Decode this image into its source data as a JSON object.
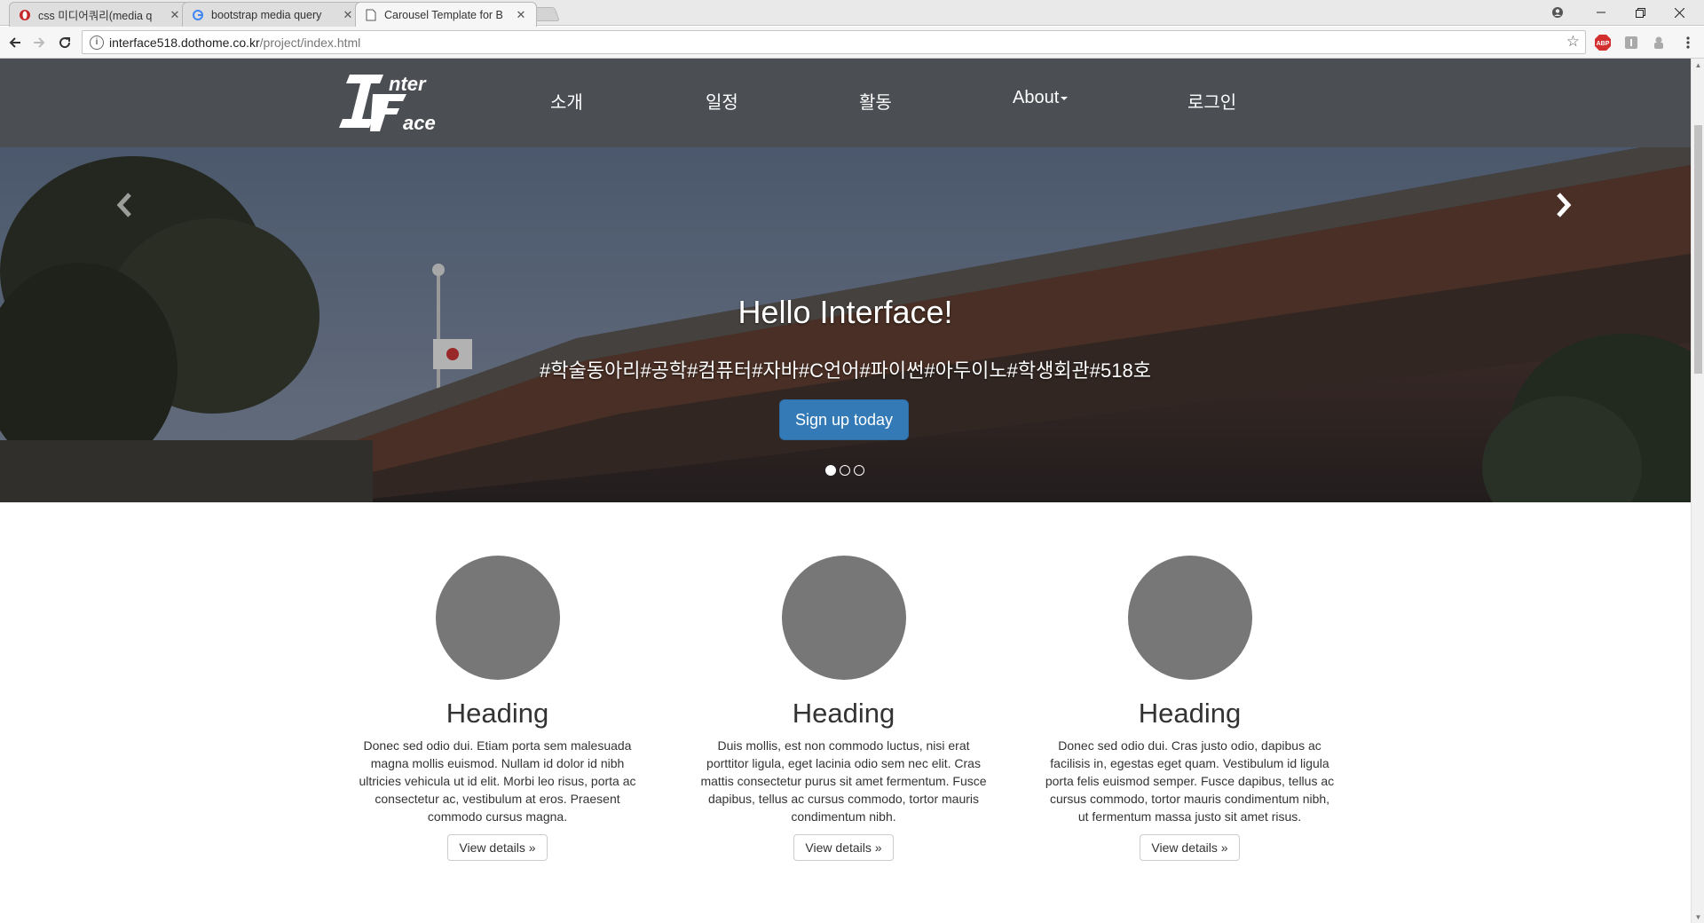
{
  "browser": {
    "tabs": [
      {
        "title": "css 미디어쿼리(media q",
        "favicon": "opera-favicon-icon"
      },
      {
        "title": "bootstrap media query",
        "favicon": "google-favicon-icon"
      },
      {
        "title": "Carousel Template for B",
        "favicon": "page-favicon-icon"
      }
    ],
    "tab_close": "✕",
    "url_host": "interface518.dothome.co.kr",
    "url_path": "/project/index.html",
    "ext_abp": "ABP"
  },
  "navbar": {
    "logo_alt": "Inter Face",
    "logo_top": "nter",
    "logo_bottom": "ace",
    "items": [
      "소개",
      "일정",
      "활동",
      "About",
      "로그인"
    ]
  },
  "carousel": {
    "title": "Hello Interface!",
    "subtitle": "#학술동아리#공학#컴퓨터#자바#C언어#파이썬#아두이노#학생회관#518호",
    "button": "Sign up today",
    "slide_count": 3,
    "active_slide": 0
  },
  "columns": [
    {
      "heading": "Heading",
      "text": "Donec sed odio dui. Etiam porta sem malesuada magna mollis euismod. Nullam id dolor id nibh ultricies vehicula ut id elit. Morbi leo risus, porta ac consectetur ac, vestibulum at eros. Praesent commodo cursus magna.",
      "button": "View details »"
    },
    {
      "heading": "Heading",
      "text": "Duis mollis, est non commodo luctus, nisi erat porttitor ligula, eget lacinia odio sem nec elit. Cras mattis consectetur purus sit amet fermentum. Fusce dapibus, tellus ac cursus commodo, tortor mauris condimentum nibh.",
      "button": "View details »"
    },
    {
      "heading": "Heading",
      "text": "Donec sed odio dui. Cras justo odio, dapibus ac facilisis in, egestas eget quam. Vestibulum id ligula porta felis euismod semper. Fusce dapibus, tellus ac cursus commodo, tortor mauris condimentum nibh, ut fermentum massa justo sit amet risus.",
      "button": "View details »"
    }
  ],
  "colors": {
    "navbar": "#4b4e53",
    "primary_button": "#337ab7",
    "placeholder_circle": "#777777"
  }
}
